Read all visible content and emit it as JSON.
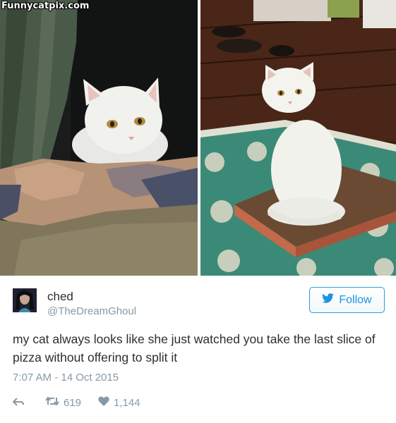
{
  "watermark": "Funnycatpix.com",
  "tweet": {
    "display_name": "ched",
    "handle": "@TheDreamGhoul",
    "follow_label": "Follow",
    "text": "my cat always looks like she just watched you take the last slice of pizza without offering to split it",
    "timestamp": "7:07 AM - 14 Oct 2015",
    "retweets": "619",
    "likes": "1,144"
  },
  "icons": {
    "follow": "twitter-bird-icon",
    "reply": "reply-arrow-icon",
    "retweet": "retweet-icon",
    "like": "heart-icon"
  },
  "colors": {
    "twitter_blue": "#1b95e0",
    "text": "#292f33",
    "muted": "#8899a6"
  }
}
